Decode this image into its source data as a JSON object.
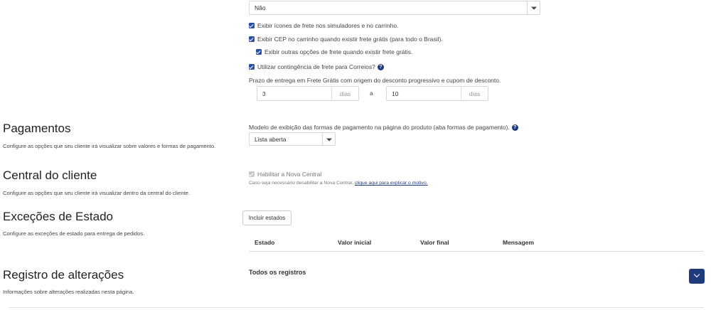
{
  "frete": {
    "select_value": "Não",
    "checkboxes": [
      {
        "label": "Exibir ícones de frete nos simuladores e no carrinho.",
        "checked": true
      },
      {
        "label": "Exibir CEP no carrinho quando existir frete grátis (para todo o Brasil).",
        "checked": true
      },
      {
        "label": "Exibir outras opções de frete quando existir frete grátis.",
        "checked": true
      },
      {
        "label": "Utilizar contingência de frete para Correios?",
        "checked": true
      }
    ],
    "prazo_label": "Prazo de entrega em Frete Grátis com origem do desconto progressivo e cupom de desconto.",
    "prazo_min": "3",
    "prazo_max": "10",
    "unit": "dias",
    "separator": "a"
  },
  "pagamentos": {
    "title": "Pagamentos",
    "desc": "Configure as opções que seu cliente irá visualizar sobre valores e formas de pagamento.",
    "modelo_label": "Modelo de exibição das formas de pagamento na página do produto (aba formas de pagamento).",
    "select_value": "Lista aberta"
  },
  "central": {
    "title": "Central do cliente",
    "desc": "Configure as opções que seu cliente irá visualizar dentro da central do cliente.",
    "checkbox_label": "Habilitar a Nova Central",
    "note": "Caso seja necessário desabilitar a Nova Central,",
    "link": "clique aqui para explicar o motivo."
  },
  "excecoes": {
    "title": "Exceções de Estado",
    "desc": "Configure as exceções de estado para entrega de pedidos.",
    "button": "Incluir estados",
    "columns": [
      "Estado",
      "Valor inicial",
      "Valor final",
      "Mensagem"
    ]
  },
  "registro": {
    "title": "Registro de alterações",
    "desc": "Informações sobre alterações realizadas nesta página.",
    "todos": "Todos os registros"
  },
  "icons": {
    "help": "question-circle-icon",
    "expand": "chevron-down-icon",
    "dropdown": "caret-down-icon"
  },
  "colors": {
    "accent": "#1f3c7a",
    "checkbox": "#2b4fa3"
  }
}
